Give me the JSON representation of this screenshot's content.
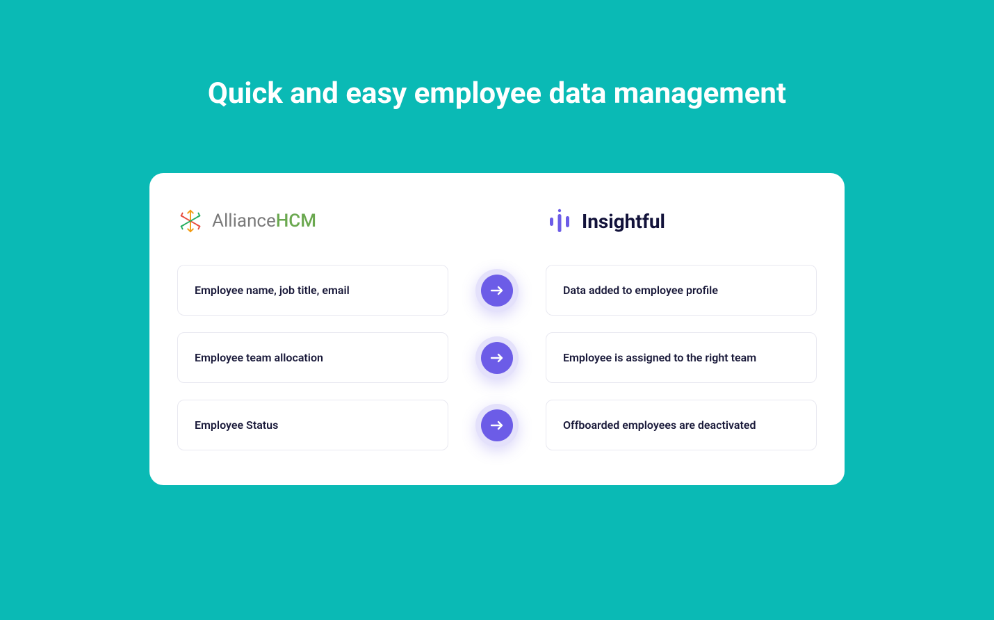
{
  "title": "Quick and easy employee data management",
  "left": {
    "brand_first": "Alliance",
    "brand_second": "HCM",
    "items": [
      "Employee name, job title, email",
      "Employee team allocation",
      "Employee Status"
    ]
  },
  "right": {
    "brand": "Insightful",
    "items": [
      "Data added to employee profile",
      "Employee is assigned to the right team",
      "Offboarded employees are deactivated"
    ]
  },
  "colors": {
    "background": "#0abab5",
    "arrow": "#6c5ce7",
    "arrow_halo": "#e4e1fb"
  }
}
